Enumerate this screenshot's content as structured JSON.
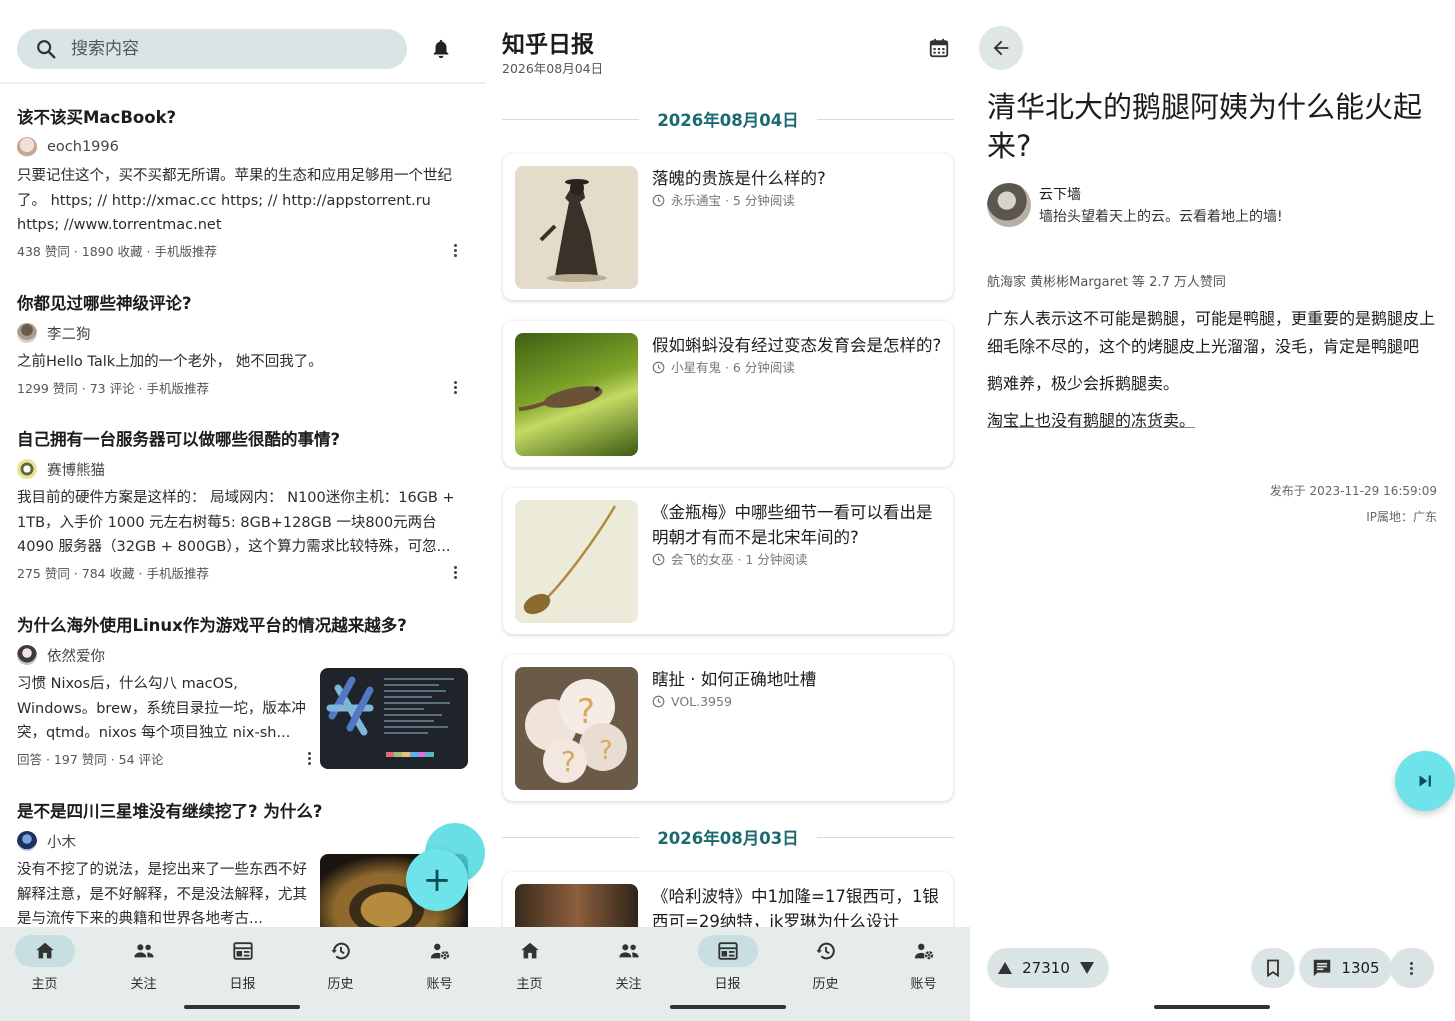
{
  "screen1": {
    "search_placeholder": "搜索内容",
    "items": [
      {
        "title": "该不该买MacBook?",
        "author": "eoch1996",
        "excerpt": "只要记住这个，买不买都无所谓。苹果的生态和应用足够用一个世纪了。 https; // http://xmac.cc https; // http://appstorrent.ru https; //www.torrentmac.net",
        "meta": "438 赞同 · 1890 收藏 · 手机版推荐"
      },
      {
        "title": "你都见过哪些神级评论?",
        "author": "李二狗",
        "excerpt": "之前Hello Talk上加的一个老外， 她不回我了。",
        "meta": "1299 赞同 · 73 评论 · 手机版推荐"
      },
      {
        "title": "自己拥有一台服务器可以做哪些很酷的事情?",
        "author": "赛博熊猫",
        "excerpt": "我目前的硬件方案是这样的：  局域网内： N100迷你主机：16GB + 1TB，入手价 1000 元左右树莓5: 8GB+128GB 一块800元两台 4090 服务器（32GB + 800GB），这个算力需求比较特殊，可忽...",
        "meta": "275 赞同 · 784 收藏 · 手机版推荐"
      },
      {
        "title": "为什么海外使用Linux作为游戏平台的情况越来越多?",
        "author": "依然爱你",
        "excerpt": "习惯 Nixos后，什么勾八 macOS, Windows。brew，系统目录拉一坨，版本冲突，qtmd。nixos 每个项目独立 nix-sh...",
        "meta": "回答 · 197 赞同 · 54 评论"
      },
      {
        "title": "是不是四川三星堆没有继续挖了? 为什么?",
        "author": "小木",
        "excerpt": "没有不挖了的说法，是挖出来了一些东西不好解释注意，是不好解释，不是没法解释，尤其是与流传下来的典籍和世界各地考古...",
        "meta": ""
      }
    ],
    "nav_active": 0
  },
  "nav": [
    {
      "label": "主页",
      "icon": "home-icon"
    },
    {
      "label": "关注",
      "icon": "people-icon"
    },
    {
      "label": "日报",
      "icon": "newspaper-icon"
    },
    {
      "label": "历史",
      "icon": "history-icon"
    },
    {
      "label": "账号",
      "icon": "account-settings-icon"
    }
  ],
  "screen2": {
    "title": "知乎日报",
    "subtitle": "2026年08月04日",
    "date1": "2026年08月04日",
    "date2": "2026年08月03日",
    "stories": [
      {
        "title": "落魄的贵族是什么样的?",
        "meta": "永乐通宝 · 5 分钟阅读"
      },
      {
        "title": "假如蝌蚪没有经过变态发育会是怎样的?",
        "meta": "小星有鬼 · 6 分钟阅读"
      },
      {
        "title": "《金瓶梅》中哪些细节一看可以看出是明朝才有而不是北宋年间的?",
        "meta": "会飞的女巫 · 1 分钟阅读"
      },
      {
        "title": "瞎扯 · 如何正确地吐槽",
        "meta": "VOL.3959"
      },
      {
        "title": "《哈利波特》中1加隆=17银西可，1银西可=29纳特，jk罗琳为什么设计",
        "meta": ""
      }
    ],
    "nav_active": 2
  },
  "screen3": {
    "title": "清华北大的鹅腿阿姨为什么能火起来?",
    "author_name": "云下墙",
    "author_bio": "墙抬头望着天上的云。云看着地上的墙!",
    "upvoters": "航海家 黄彬彬Margaret 等 2.7 万人赞同",
    "para1": "广东人表示这不可能是鹅腿，可能是鸭腿，更重要的是鹅腿皮上细毛除不尽的，这个的烤腿皮上光溜溜，没毛，肯定是鸭腿吧",
    "para2": "鹅难养，极少会拆鹅腿卖。",
    "para3": "淘宝上也没有鹅腿的冻货卖。",
    "published": "发布于 2023-11-29 16:59:09",
    "ip": "IP属地：广东",
    "votes": "27310",
    "comments": "1305"
  },
  "colors": {
    "accent": "#6fe3ea",
    "date_header": "#1a6a6f",
    "nav_bg": "#e6ebeb",
    "chip_bg": "#dbe4e4"
  }
}
